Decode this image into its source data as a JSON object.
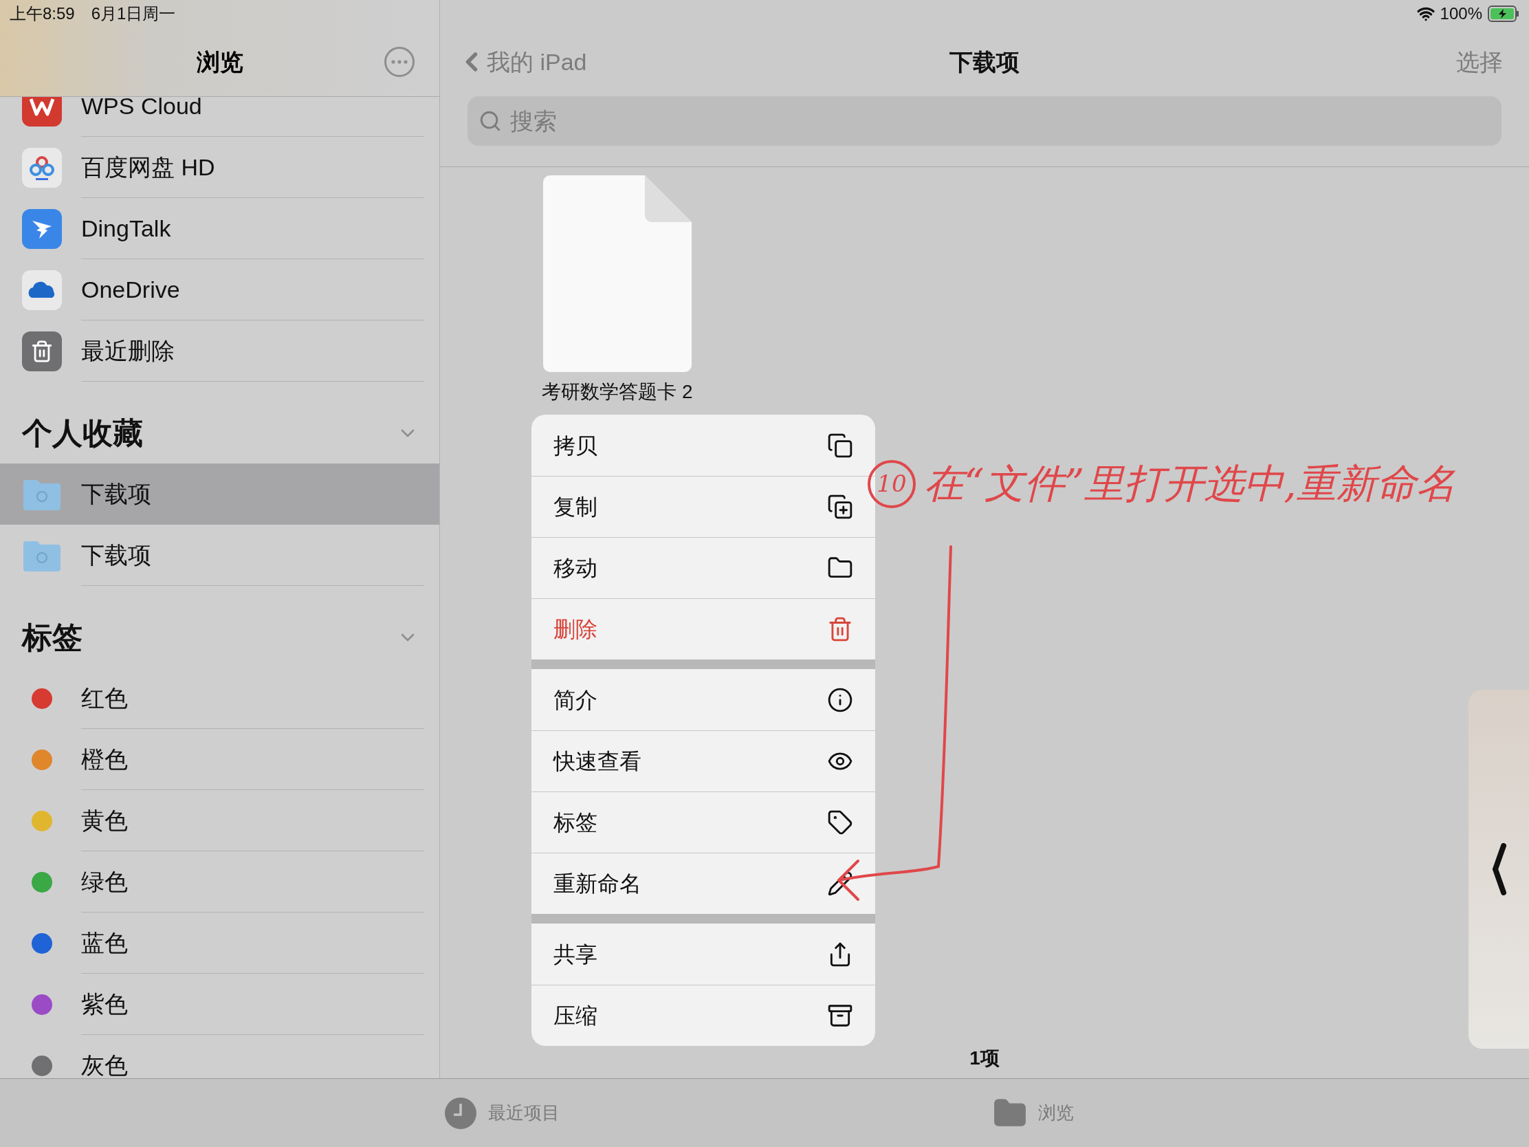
{
  "status_bar": {
    "time": "上午8:59",
    "date": "6月1日周一",
    "battery": "100%"
  },
  "sidebar": {
    "title": "浏览",
    "locations": [
      {
        "label": "WPS Cloud",
        "kind": "wps"
      },
      {
        "label": "百度网盘 HD",
        "kind": "baidu"
      },
      {
        "label": "DingTalk",
        "kind": "dingtalk"
      },
      {
        "label": "OneDrive",
        "kind": "onedrive"
      },
      {
        "label": "最近删除",
        "kind": "trash"
      }
    ],
    "favorites": {
      "title": "个人收藏",
      "expanded": true,
      "items": [
        {
          "label": "下载项",
          "selected": true
        },
        {
          "label": "下载项",
          "selected": false
        }
      ]
    },
    "tags": {
      "title": "标签",
      "expanded": true,
      "items": [
        {
          "label": "红色",
          "color": "#d63a31"
        },
        {
          "label": "橙色",
          "color": "#e0862b"
        },
        {
          "label": "黄色",
          "color": "#e0b62f"
        },
        {
          "label": "绿色",
          "color": "#3aa845"
        },
        {
          "label": "蓝色",
          "color": "#1f63d6"
        },
        {
          "label": "紫色",
          "color": "#9b4bc6"
        },
        {
          "label": "灰色",
          "color": "#707073"
        }
      ]
    }
  },
  "nav": {
    "back": "我的 iPad",
    "title": "下载项",
    "action": "选择"
  },
  "search": {
    "placeholder": "搜索"
  },
  "file": {
    "name": "考研数学答题卡 2"
  },
  "context_menu": [
    [
      {
        "label": "拷贝",
        "kind": "normal"
      },
      {
        "label": "复制",
        "kind": "normal"
      },
      {
        "label": "移动",
        "kind": "normal"
      },
      {
        "label": "删除",
        "kind": "destructive"
      }
    ],
    [
      {
        "label": "简介",
        "kind": "normal"
      },
      {
        "label": "快速查看",
        "kind": "normal"
      },
      {
        "label": "标签",
        "kind": "normal"
      },
      {
        "label": "重新命名",
        "kind": "normal"
      }
    ],
    [
      {
        "label": "共享",
        "kind": "normal"
      },
      {
        "label": "压缩",
        "kind": "normal"
      }
    ]
  ],
  "item_count": "1项",
  "annotation": {
    "number": "10",
    "text": "在“文件”里打开选中,重新命名"
  },
  "tab_bar": [
    {
      "label": "最近项目"
    },
    {
      "label": "浏览"
    }
  ]
}
